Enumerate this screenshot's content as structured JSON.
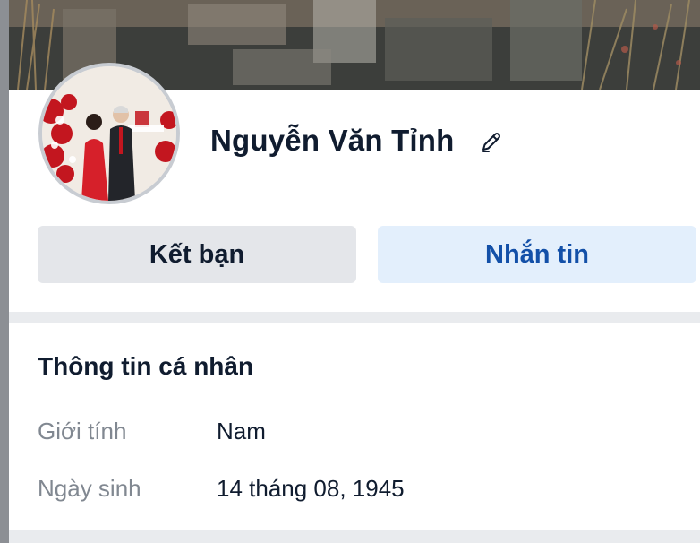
{
  "profile": {
    "name": "Nguyễn Văn Tỉnh",
    "avatar_icon": "profile-photo"
  },
  "actions": {
    "add_friend_label": "Kết bạn",
    "message_label": "Nhắn tin"
  },
  "personal_info": {
    "title": "Thông tin cá nhân",
    "rows": [
      {
        "label": "Giới tính",
        "value": "Nam"
      },
      {
        "label": "Ngày sinh",
        "value": "14 tháng 08, 1945"
      }
    ]
  },
  "colors": {
    "primary_text": "#101c2f",
    "secondary_text": "#818891",
    "accent_blue": "#1350a8",
    "message_button_bg": "#e3effc",
    "friend_button_bg": "#e4e6ea"
  }
}
